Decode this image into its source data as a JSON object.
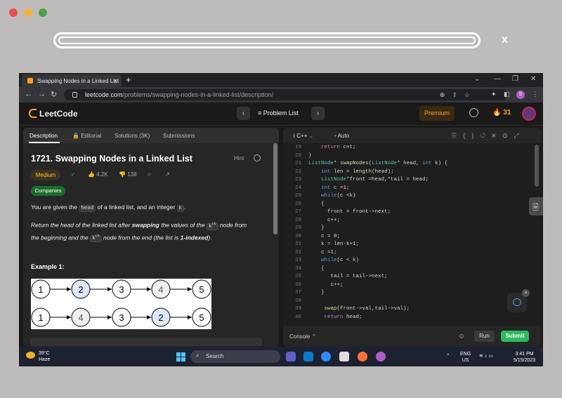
{
  "browser": {
    "tab_title": "Swapping Nodes in a Linked List",
    "tab_close": "×",
    "new_tab": "+",
    "url_host": "leetcode.com",
    "url_path": "/problems/swapping-nodes-in-a-linked-list/description/",
    "profile_initial": "S",
    "outer_close": "x"
  },
  "header": {
    "logo": "LeetCode",
    "problem_list": "Problem List",
    "premium": "Premium",
    "streak": "31"
  },
  "left_tabs": [
    "Description",
    "Editorial",
    "Solutions (3K)",
    "Submissions"
  ],
  "problem": {
    "title": "1721. Swapping Nodes in a Linked List",
    "hint": "Hint",
    "difficulty": "Medium",
    "likes": "4.2K",
    "dislikes": "138",
    "companies": "Companies",
    "p1_a": "You are given the ",
    "p1_code1": "head",
    "p1_b": " of a linked list, and an integer ",
    "p1_code2": "k",
    "p1_c": ".",
    "p2_a": "Return the head of the linked list after ",
    "p2_bold": "swapping",
    "p2_b": " the values of the ",
    "p2_k1": "k",
    "p2_sup1": "th",
    "p2_c": " node from",
    "p2_d": "the beginning and the ",
    "p2_k2": "k",
    "p2_sup2": "th",
    "p2_e": " node from the end (the list is ",
    "p2_bold2": "1-indexed",
    "p2_f": ").",
    "example_title": "Example 1:",
    "row1": [
      "1",
      "2",
      "3",
      "4",
      "5"
    ],
    "row2": [
      "1",
      "4",
      "3",
      "2",
      "5"
    ]
  },
  "editor": {
    "language": "C++",
    "mode": "Auto",
    "lines": [
      {
        "n": "19",
        "t": "    return cnt;"
      },
      {
        "n": "20",
        "t": "}"
      },
      {
        "n": "21",
        "t": "ListNode* swapNodes(ListNode* head, int k) {"
      },
      {
        "n": "22",
        "t": "    int len = length(head);"
      },
      {
        "n": "23",
        "t": "    ListNode*front =head,*tail = head;"
      },
      {
        "n": "24",
        "t": "    int c =1;"
      },
      {
        "n": "25",
        "t": "    while(c <k)"
      },
      {
        "n": "26",
        "t": "    {"
      },
      {
        "n": "27",
        "t": "      front = front->next;"
      },
      {
        "n": "28",
        "t": "      c++;"
      },
      {
        "n": "29",
        "t": "    }"
      },
      {
        "n": "30",
        "t": "    c = 0;"
      },
      {
        "n": "31",
        "t": "    k = len-k+1;"
      },
      {
        "n": "32",
        "t": "    c =1;"
      },
      {
        "n": "33",
        "t": "    while(c < k)"
      },
      {
        "n": "34",
        "t": "    {"
      },
      {
        "n": "35",
        "t": "       tail = tail->next;"
      },
      {
        "n": "36",
        "t": "       c++;"
      },
      {
        "n": "37",
        "t": "    }"
      },
      {
        "n": "38",
        "t": ""
      },
      {
        "n": "39",
        "t": "     swap(front->val,tail->val);"
      },
      {
        "n": "40",
        "t": "     return head;"
      }
    ],
    "console": "Console",
    "run": "Run",
    "submit": "Submit"
  },
  "taskbar": {
    "temp": "39°C",
    "weather": "Haze",
    "search": "Search",
    "lang": "ENG",
    "region": "US",
    "time": "3:41 PM",
    "date": "5/15/2023"
  },
  "colors": {
    "accent": "#ffa116",
    "submit": "#2cbb5d",
    "difficulty": "#ffc01e"
  }
}
